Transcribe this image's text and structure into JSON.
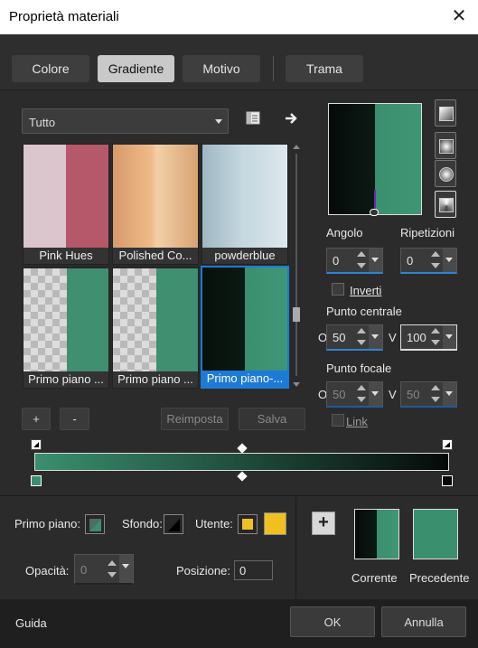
{
  "window": {
    "title": "Proprietà materiali",
    "close_glyph": "✕"
  },
  "tabs": [
    {
      "label": "Colore",
      "active": false
    },
    {
      "label": "Gradiente",
      "active": true
    },
    {
      "label": "Motivo",
      "active": false
    },
    {
      "label": "Trama",
      "active": false
    }
  ],
  "library": {
    "category_value": "Tutto",
    "thumbnails": [
      {
        "caption": "Pink Hues"
      },
      {
        "caption": "Polished Co..."
      },
      {
        "caption": "powderblue"
      },
      {
        "caption": "Primo piano ..."
      },
      {
        "caption": "Primo piano ..."
      },
      {
        "caption": "Primo piano-..."
      }
    ],
    "add_label": "+",
    "remove_label": "-",
    "reset_label": "Reimposta",
    "save_label": "Salva"
  },
  "gradient_options": {
    "angle_label": "Angolo",
    "angle_value": "0",
    "repeats_label": "Ripetizioni",
    "repeats_value": "0",
    "invert_label": "Inverti",
    "center_label": "Punto centrale",
    "center_h_label": "O",
    "center_h_value": "50",
    "center_v_label": "V",
    "center_v_value": "100",
    "focal_label": "Punto focale",
    "focal_h_label": "O",
    "focal_h_value": "50",
    "focal_v_label": "V",
    "focal_v_value": "50",
    "link_label": "Link"
  },
  "stops": {
    "foreground_label": "Primo piano:",
    "background_label": "Sfondo:",
    "user_label": "Utente:",
    "opacity_label": "Opacità:",
    "opacity_value": "0",
    "position_label": "Posizione:",
    "position_value": "0"
  },
  "preview": {
    "add_label": "+",
    "current_label": "Corrente",
    "previous_label": "Precedente"
  },
  "footer": {
    "help_label": "Guida",
    "ok_label": "OK",
    "cancel_label": "Annulla"
  },
  "colors": {
    "accent": "#1e7ad7",
    "gradient_start": "#3a8f6f",
    "gradient_end": "#050a08",
    "user_swatch": "#f0c020"
  }
}
